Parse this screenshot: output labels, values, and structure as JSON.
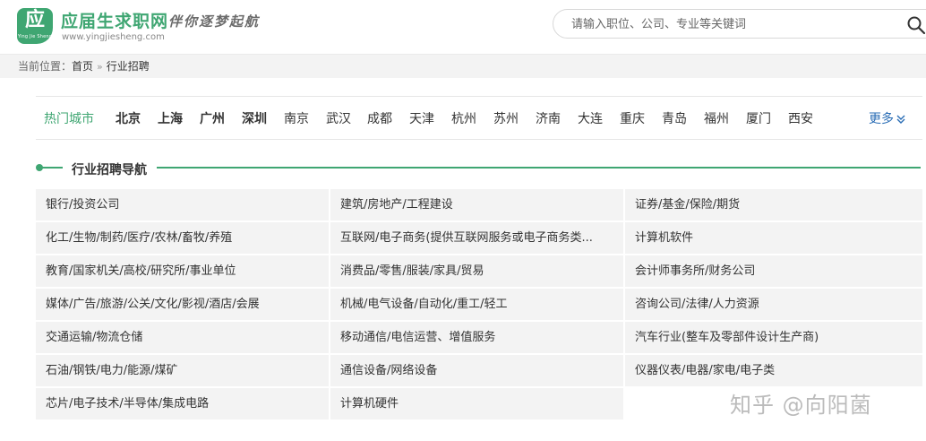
{
  "header": {
    "logo_glyph": "应",
    "logo_small": "Ying Jie Sheng",
    "logo_name": "应届生求职网",
    "logo_slogan": "伴你逐梦起航",
    "logo_domain": "www.yingjiesheng.com",
    "search_placeholder": "请输入职位、公司、专业等关键词",
    "search_value": ""
  },
  "breadcrumb": {
    "prefix": "当前位置：",
    "home": "首页",
    "separator": "»",
    "current": "行业招聘"
  },
  "cities": {
    "title": "热门城市",
    "items": [
      {
        "label": "北京",
        "bold": true
      },
      {
        "label": "上海",
        "bold": true
      },
      {
        "label": "广州",
        "bold": true
      },
      {
        "label": "深圳",
        "bold": true
      },
      {
        "label": "南京",
        "bold": false
      },
      {
        "label": "武汉",
        "bold": false
      },
      {
        "label": "成都",
        "bold": false
      },
      {
        "label": "天津",
        "bold": false
      },
      {
        "label": "杭州",
        "bold": false
      },
      {
        "label": "苏州",
        "bold": false
      },
      {
        "label": "济南",
        "bold": false
      },
      {
        "label": "大连",
        "bold": false
      },
      {
        "label": "重庆",
        "bold": false
      },
      {
        "label": "青岛",
        "bold": false
      },
      {
        "label": "福州",
        "bold": false
      },
      {
        "label": "厦门",
        "bold": false
      },
      {
        "label": "西安",
        "bold": false
      }
    ],
    "more": "更多"
  },
  "section": {
    "title": "行业招聘导航"
  },
  "industries": [
    [
      "银行/投资公司",
      "建筑/房地产/工程建设",
      "证券/基金/保险/期货"
    ],
    [
      "化工/生物/制药/医疗/农林/畜牧/养殖",
      "互联网/电子商务(提供互联网服务或电子商务类...",
      "计算机软件"
    ],
    [
      "教育/国家机关/高校/研究所/事业单位",
      "消费品/零售/服装/家具/贸易",
      "会计师事务所/财务公司"
    ],
    [
      "媒体/广告/旅游/公关/文化/影视/酒店/会展",
      "机械/电气设备/自动化/重工/轻工",
      "咨询公司/法律/人力资源"
    ],
    [
      "交通运输/物流仓储",
      "移动通信/电信运营、增值服务",
      "汽车行业(整车及零部件设计生产商)"
    ],
    [
      "石油/钢铁/电力/能源/煤矿",
      "通信设备/网络设备",
      "仪器仪表/电器/家电/电子类"
    ],
    [
      "芯片/电子技术/半导体/集成电路",
      "计算机硬件"
    ]
  ],
  "watermark": "知乎 @向阳菌",
  "colors": {
    "brand_green": "#3fa672",
    "link_blue": "#2a6db5",
    "cell_bg": "#f3f3f3"
  }
}
